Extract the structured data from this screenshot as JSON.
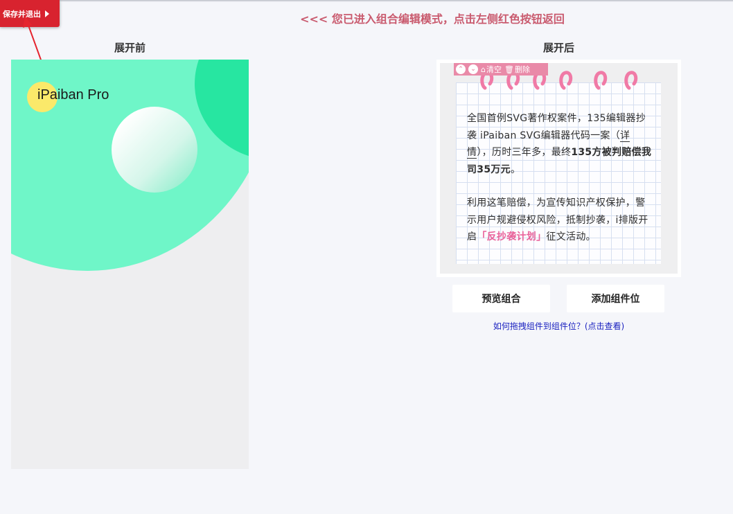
{
  "header": {
    "save_exit_label": "保存并退出",
    "mode_hint": "<<< 您已进入组合编辑模式，点击左侧红色按钮返回"
  },
  "editor": {
    "before_title": "展开前",
    "after_title": "展开后",
    "before_panel": {
      "brand_text": "iPaiban Pro"
    },
    "after_panel": {
      "toolbar": {
        "up_icon": "chevron-up-circle-icon",
        "down_icon": "chevron-down-circle-icon",
        "clear_label": "清空",
        "delete_label": "删除"
      },
      "notebook": {
        "para1_part1": "全国首例SVG著作权案件，135编辑器抄袭 iPaiban SVG编辑器代码一案（",
        "para1_link": "详情",
        "para1_part2": "），历时三年多，最终",
        "para1_bold": "135方被判赔偿我司35万元",
        "para1_end": "。",
        "para2_before": "利用这笔赔偿，为宣传知识产权保护，警示用户规避侵权风险，抵制抄袭，i排版开启",
        "para2_highlight": "「反抄袭计划」",
        "para2_after": "征文活动。"
      }
    },
    "actions": {
      "preview_label": "预览组合",
      "add_slot_label": "添加组件位"
    },
    "help_link": "如何拖拽组件到组件位？(点击查看)"
  },
  "colors": {
    "save_button": "#d8232f",
    "hint_text": "#c95a6e",
    "mint_circle": "#6ff6c8",
    "green_circle": "#27e6a1",
    "yellow_dot": "#fbe96a",
    "toolbar_pink": "#e98aa8",
    "ring_pink": "#f07aa6",
    "highlight_pink": "#e9629a",
    "link_blue": "#1b22c0"
  }
}
